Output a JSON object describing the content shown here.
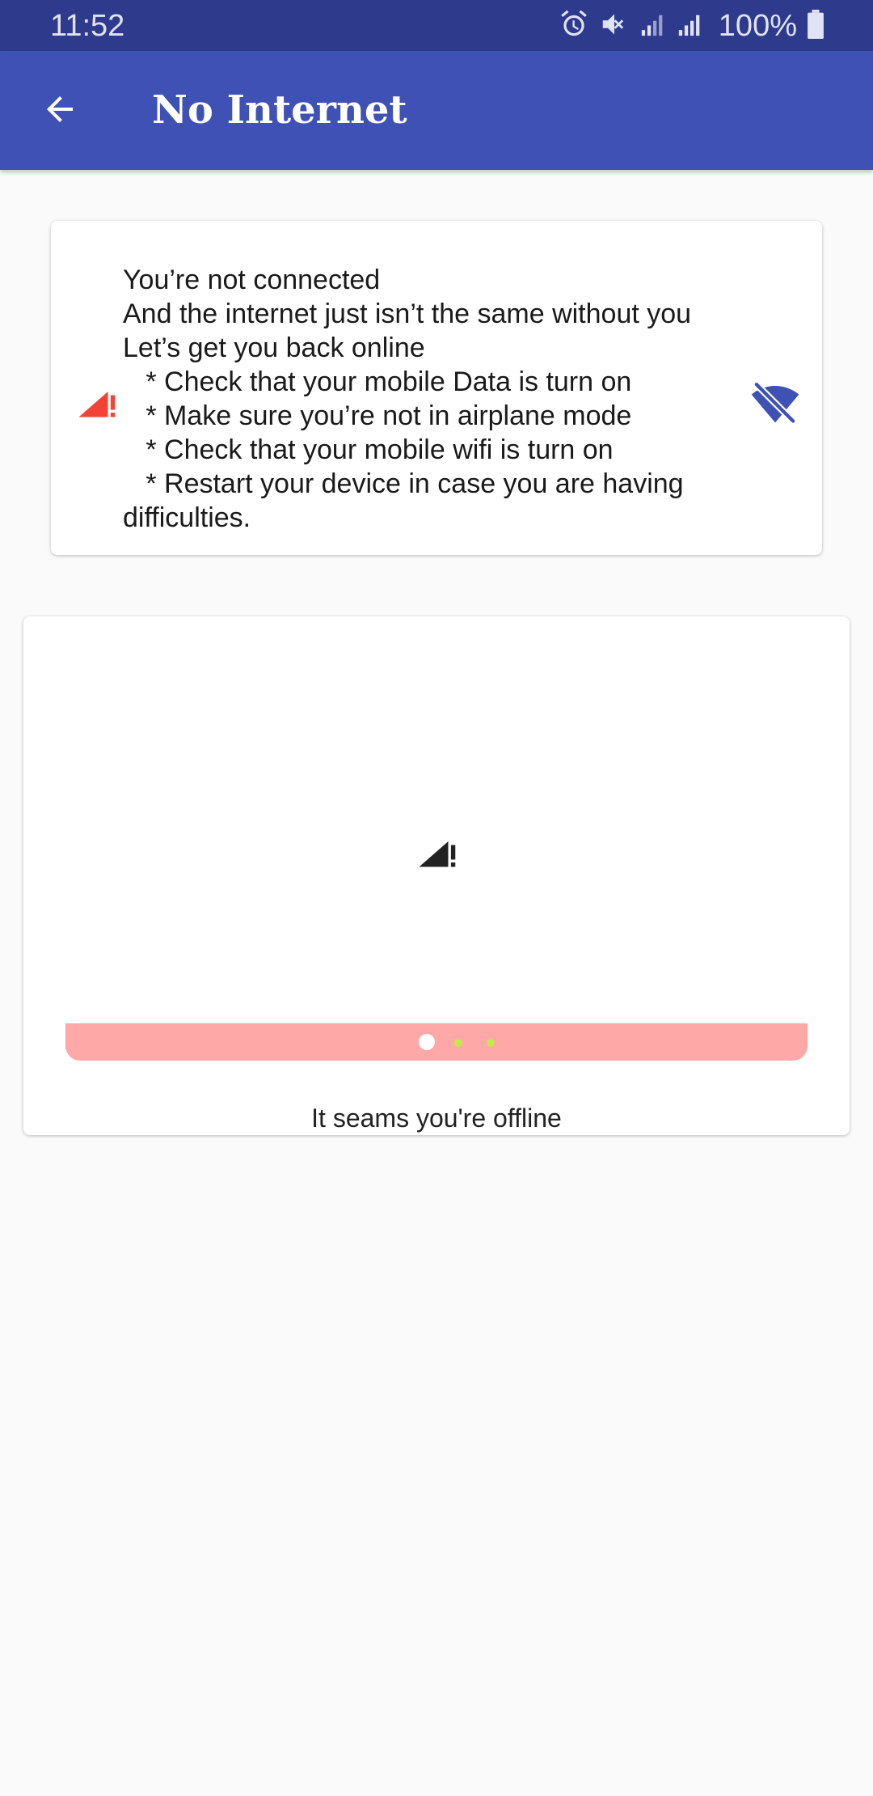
{
  "status_bar": {
    "time": "11:52",
    "battery": "100%",
    "icons": [
      "alarm-icon",
      "mute-icon",
      "signal-icon",
      "signal-icon",
      "battery-icon"
    ]
  },
  "app_bar": {
    "title": "No Internet",
    "back_icon": "arrow-back-icon"
  },
  "info_card": {
    "text": "You’re not connected\nAnd the internet just isn’t the same without you\nLet’s get you back online\n   * Check that your mobile Data is turn on\n   * Make sure you’re not in airplane mode\n   * Check that your mobile wifi is turn on\n   * Restart your device in case you are having difficulties.",
    "left_icon": "signal-alert-icon",
    "right_icon": "wifi-off-icon"
  },
  "offline_card": {
    "icon": "signal-alert-icon",
    "message": "It seams you're offline"
  },
  "colors": {
    "status_bar": "#2e3a8c",
    "app_bar": "#3f51b5",
    "alert_red": "#f44336",
    "wifi_off_blue": "#3f51b5",
    "progress_bg": "#ffa8a8",
    "progress_dot_active": "#ffffff",
    "progress_dot_inactive": "#c6e84a"
  }
}
